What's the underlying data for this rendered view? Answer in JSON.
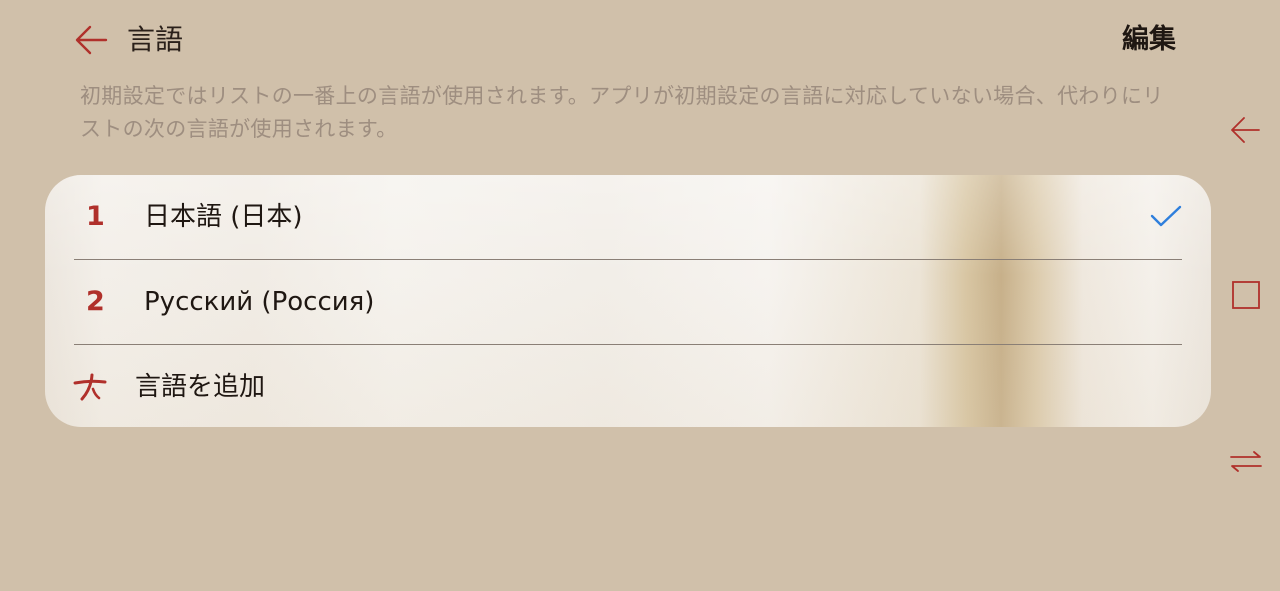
{
  "header": {
    "title": "言語",
    "edit_label": "編集"
  },
  "description": "初期設定ではリストの一番上の言語が使用されます。アプリが初期設定の言語に対応していない場合、代わりにリストの次の言語が使用されます。",
  "languages": [
    {
      "index": "1",
      "label": "日本語 (日本)",
      "selected": true
    },
    {
      "index": "2",
      "label": "Русский (Россия)",
      "selected": false
    }
  ],
  "add_language_label": "言語を追加",
  "colors": {
    "background": "#d0c0aa",
    "accent_red": "#b0302b",
    "check_blue": "#2f7fdc",
    "description_gray": "#9e8e80"
  },
  "icons": {
    "back": "back-arrow-icon",
    "check": "checkmark-icon",
    "add": "plus-icon",
    "nav_back": "nav-back-icon",
    "nav_home": "nav-home-square-icon",
    "nav_switch": "nav-switch-icon"
  }
}
